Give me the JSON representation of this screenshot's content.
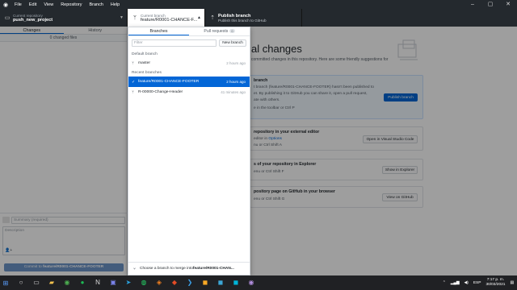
{
  "titlebar": {
    "menu": [
      "File",
      "Edit",
      "View",
      "Repository",
      "Branch",
      "Help"
    ],
    "controls": [
      "–",
      "▢",
      "✕"
    ]
  },
  "toolbar": {
    "repo_label": "Current repository",
    "repo_value": "push_new_project",
    "branch_label": "Current branch",
    "branch_value": "feature/R0001-CHANCE-F...",
    "publish_label": "Publish branch",
    "publish_sub": "Publish this branch to GitHub"
  },
  "left": {
    "tabs": [
      "Changes",
      "History"
    ],
    "changes_count": "0 changed files",
    "summary_placeholder": "Summary (required)",
    "description_placeholder": "Description",
    "commit_prefix": "Commit to",
    "commit_branch": "feature/R0001-CHANCE-FOOTER"
  },
  "main": {
    "title": "al changes",
    "subtitle": "committed changes in this repository. Here are some friendly suggestions for",
    "publish_card": {
      "title": "branch",
      "line1": "t branch (feature/R0001-CHANCE-FOOTER) hasn't been published to",
      "line2": "et. By publishing it to GitHub you can share it, open a pull request,",
      "line3": "ate with others.",
      "line4": "e in the toolbar or  Ctrl  P",
      "button": "Publish branch"
    },
    "editor_card": {
      "title": "repository in your external editor",
      "line_prefix": "editor in ",
      "line_link": "Options",
      "line2": "nu or  Ctrl  Shift  A",
      "button": "Open in Visual Studio Code"
    },
    "explorer_card": {
      "title": "s of your repository in Explorer",
      "line": "enu or  Ctrl  Shift  F",
      "button": "Show in Explorer"
    },
    "github_card": {
      "title": "pository page on GitHub in your browser",
      "line": "enu or  Ctrl  Shift  G",
      "button": "View on GitHub"
    }
  },
  "dropdown": {
    "tabs": [
      "Branches",
      "Pull requests"
    ],
    "pr_count": "0",
    "filter_placeholder": "Filter",
    "new_branch": "New branch",
    "default_header": "Default branch",
    "default_branches": [
      {
        "name": "master",
        "time": "2 hours ago"
      }
    ],
    "recent_header": "Recent branches",
    "recent_branches": [
      {
        "name": "feature/R0001-CHANCE-FOOTER",
        "time": "2 hours ago"
      },
      {
        "name": "R-00000-Change-Header",
        "time": "41 minutes ago"
      }
    ],
    "merge_prefix": "Choose a branch to merge into ",
    "merge_branch": "feature/R0001-CHAN..."
  },
  "taskbar": {
    "lang": "ESP",
    "time": "7:17 p. m.",
    "date": "30/03/2021"
  }
}
